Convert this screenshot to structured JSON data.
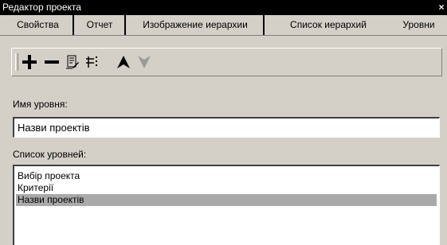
{
  "window": {
    "title": "Редактор проекта",
    "close_label": "×"
  },
  "tabs": [
    {
      "label": "Свойства"
    },
    {
      "label": "Отчет"
    },
    {
      "label": "Изображение иерархии"
    },
    {
      "label": "Список иерархий"
    },
    {
      "label": "Уровни",
      "active": true
    }
  ],
  "toolbar": {
    "buttons": [
      {
        "icon": "plus-icon",
        "enabled": true
      },
      {
        "icon": "minus-icon",
        "enabled": true
      },
      {
        "icon": "document-edit-icon",
        "enabled": true
      },
      {
        "icon": "sort-icon",
        "enabled": true
      },
      {
        "icon": "arrow-up-icon",
        "enabled": true
      },
      {
        "icon": "arrow-down-icon",
        "enabled": false
      }
    ]
  },
  "level_name": {
    "label": "Имя уровня:",
    "value": "Назви проектів"
  },
  "levels_list": {
    "label": "Список уровней:",
    "items": [
      {
        "text": "Вибір проекта",
        "selected": false
      },
      {
        "text": "Критерії",
        "selected": false
      },
      {
        "text": "Назви проектів",
        "selected": true
      }
    ]
  },
  "colors": {
    "titlebar": "#000000",
    "dialog_bg": "#d4d0c8",
    "selection": "#a9a9a9",
    "disabled_icon": "#9a9a9a"
  }
}
